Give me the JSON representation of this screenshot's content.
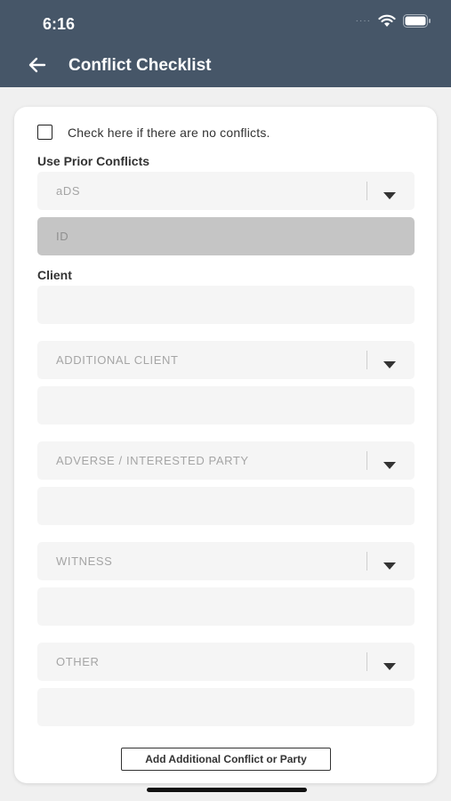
{
  "status_bar": {
    "time": "6:16"
  },
  "header": {
    "title": "Conflict Checklist"
  },
  "form": {
    "no_conflicts_label": "Check here if there are no conflicts.",
    "use_prior_label": "Use Prior Conflicts",
    "prior_select_value": "aDS",
    "id_placeholder": "ID",
    "client_label": "Client",
    "client_value": "",
    "additional_client_select": "ADDITIONAL CLIENT",
    "additional_client_value": "",
    "adverse_select": "ADVERSE / INTERESTED PARTY",
    "adverse_value": "",
    "witness_select": "WITNESS",
    "witness_value": "",
    "other_select": "OTHER",
    "other_value": "",
    "add_button_label": "Add Additional Conflict or Party"
  },
  "colors": {
    "header_bg": "#465668",
    "field_bg": "#f5f5f5",
    "disabled_bg": "#c5c5c5"
  },
  "icons": [
    "back-arrow-icon",
    "wifi-icon",
    "battery-icon",
    "chevron-down-icon"
  ]
}
